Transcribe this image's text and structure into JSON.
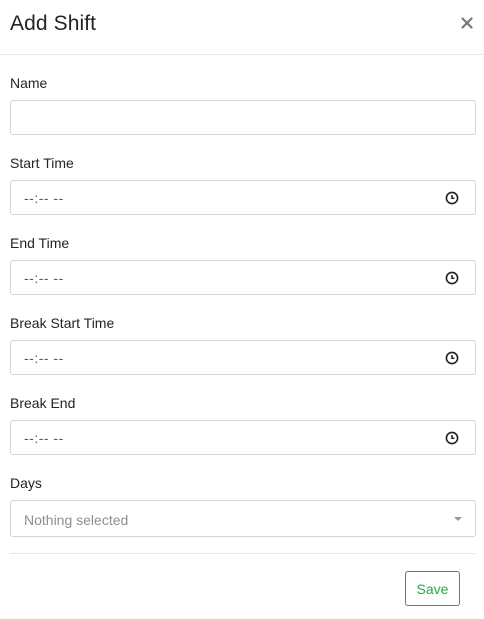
{
  "header": {
    "title": "Add Shift",
    "close_label": "×"
  },
  "fields": {
    "name": {
      "label": "Name",
      "value": "",
      "placeholder": ""
    },
    "start_time": {
      "label": "Start Time",
      "value": "--:-- --"
    },
    "end_time": {
      "label": "End Time",
      "value": "--:-- --"
    },
    "break_start_time": {
      "label": "Break Start Time",
      "value": "--:-- --"
    },
    "break_end": {
      "label": "Break End",
      "value": "--:-- --"
    },
    "days": {
      "label": "Days",
      "value": "Nothing selected"
    }
  },
  "footer": {
    "save_label": "Save"
  },
  "colors": {
    "accent_success": "#28a745",
    "border": "#ced4da",
    "divider": "#e3e6ea"
  },
  "icons": {
    "close": "close-icon",
    "clock": "clock-icon",
    "dropdown": "caret-down-icon"
  }
}
